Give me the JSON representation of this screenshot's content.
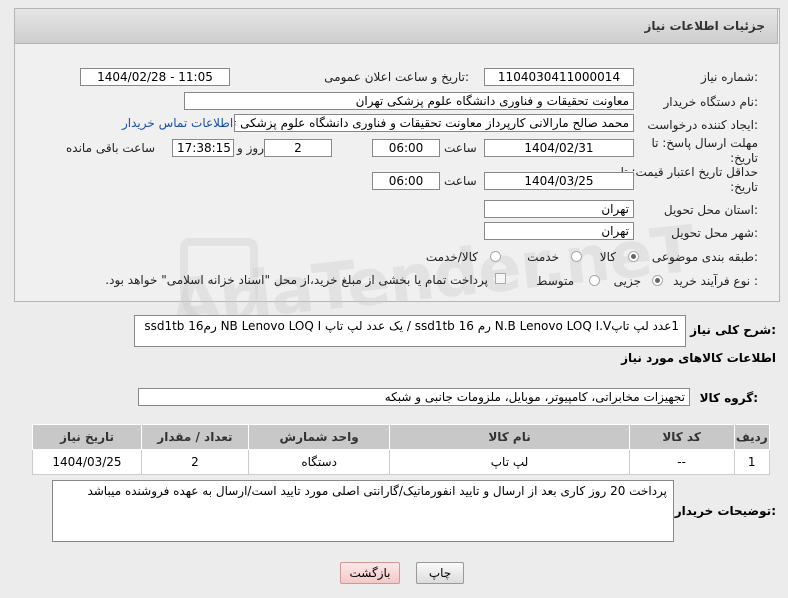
{
  "header": {
    "title": "جزئیات اطلاعات نیاز"
  },
  "form": {
    "need_number": {
      "label": "شماره نیاز:",
      "value": "1104030411000014"
    },
    "announce_datetime": {
      "label": "تاریخ و ساعت اعلان عمومی:",
      "value": "1404/02/28 - 11:05"
    },
    "buyer_org": {
      "label": "نام دستگاه خریدار:",
      "value": "معاونت تحقیقات و فناوری دانشگاه علوم پزشکی تهران"
    },
    "requester": {
      "label": "ایجاد کننده درخواست:",
      "value": "محمد صالح مارالانی کارپرداز معاونت تحقیقات و فناوری دانشگاه علوم پزشکی تهران",
      "contact_link": "اطلاعات تماس خریدار"
    },
    "reply_deadline": {
      "label": "مهلت ارسال پاسخ: تا تاریخ:",
      "date": "1404/02/31",
      "time_label": "ساعت",
      "time": "06:00",
      "days": "2",
      "days_label": "روز و",
      "remaining": "17:38:15",
      "remaining_label": "ساعت باقی مانده"
    },
    "price_validity": {
      "label": "حداقل تاریخ اعتبار قیمت: تا تاریخ:",
      "date": "1404/03/25",
      "time_label": "ساعت",
      "time": "06:00"
    },
    "delivery_province": {
      "label": "استان محل تحویل:",
      "value": "تهران"
    },
    "delivery_city": {
      "label": "شهر محل تحویل:",
      "value": "تهران"
    },
    "category": {
      "label": "طبقه بندی موضوعی:",
      "options": [
        "کالا",
        "خدمت",
        "کالا/خدمت"
      ],
      "selected": "کالا"
    },
    "process_type": {
      "label": "نوع فرآیند خرید :",
      "options": [
        "جزیی",
        "متوسط"
      ],
      "selected": "جزیی",
      "payment_note": "پرداخت تمام یا بخشی از مبلغ خرید،از محل \"اسناد خزانه اسلامی\" خواهد بود."
    }
  },
  "watermark": "AriaTender.neT",
  "description": {
    "label": "شرح کلی نیاز:",
    "value": "1عدد لپ تاپN.B Lenovo LOQ I.V   رم 16   ssd1tb  / یک عدد لپ تاپ NB Lenovo LOQ I  رم16   ssd1tb"
  },
  "goods_info": {
    "title": "اطلاعات کالاهای مورد نیاز",
    "group_label": "گروه کالا:",
    "group_value": "تجهیزات مخابراتی، کامپیوتر، موبایل، ملزومات جانبی و شبکه"
  },
  "table": {
    "headers": [
      "ردیف",
      "کد کالا",
      "نام کالا",
      "واحد شمارش",
      "تعداد / مقدار",
      "تاریخ نیاز"
    ],
    "rows": [
      [
        "1",
        "--",
        "لپ تاپ",
        "دستگاه",
        "2",
        "1404/03/25"
      ]
    ]
  },
  "buyer_notes": {
    "label": "توضیحات خریدار:",
    "value": "پرداخت 20 روز کاری بعد از ارسال و تایید انفورماتیک/گارانتی اصلی مورد تایید است/ارسال به عهده فروشنده میباشد"
  },
  "buttons": {
    "print": "چاپ",
    "back": "بازگشت"
  }
}
